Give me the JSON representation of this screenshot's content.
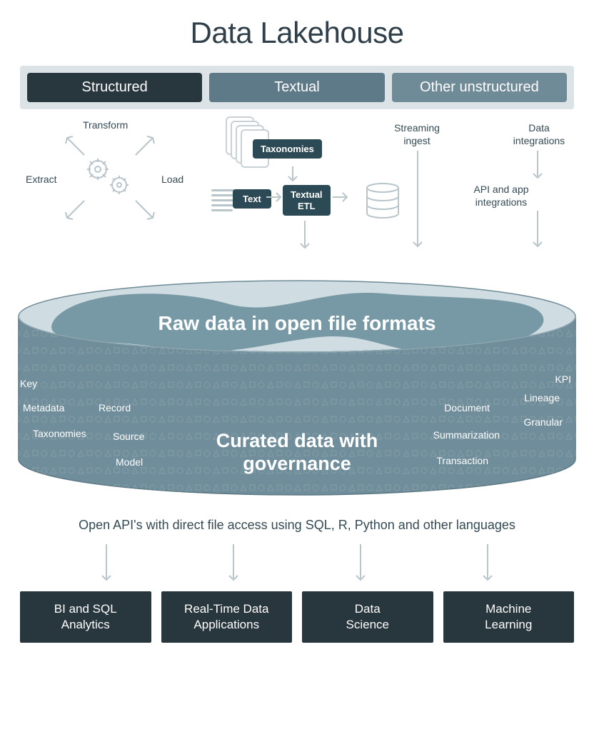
{
  "title": "Data Lakehouse",
  "categories": {
    "structured": "Structured",
    "textual": "Textual",
    "other": "Other unstructured"
  },
  "structured": {
    "transform": "Transform",
    "extract": "Extract",
    "load": "Load"
  },
  "textual": {
    "taxonomies": "Taxonomies",
    "text": "Text",
    "textual_etl": "Textual\nETL"
  },
  "ingest": {
    "streaming": "Streaming\ningest",
    "data_integrations": "Data\nintegrations",
    "api_app": "API and app\nintegrations"
  },
  "lake": {
    "raw": "Raw data in open file formats",
    "curated": "Curated data with\ngovernance",
    "left_labels": [
      "Key",
      "Metadata",
      "Taxonomies",
      "Record",
      "Source",
      "Model"
    ],
    "right_labels": [
      "KPI",
      "Lineage",
      "Granular",
      "Document",
      "Summarization",
      "Transaction"
    ]
  },
  "api_text": "Open API's with direct file access using SQL, R, Python and other languages",
  "outputs": [
    "BI and SQL\nAnalytics",
    "Real-Time Data\nApplications",
    "Data\nScience",
    "Machine\nLearning"
  ]
}
